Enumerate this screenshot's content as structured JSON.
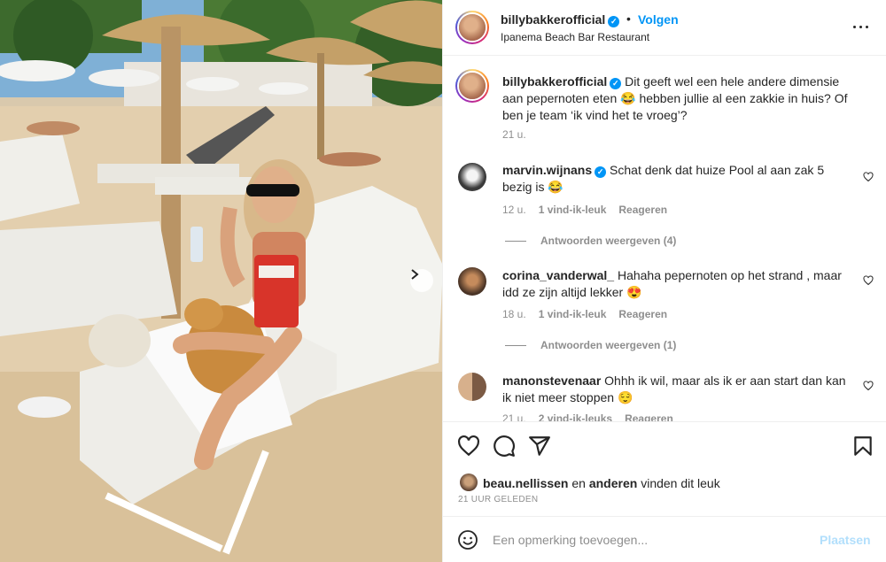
{
  "post": {
    "username": "billybakkerofficial",
    "verified": true,
    "follow_label": "Volgen",
    "separator": "•",
    "location": "Ipanema Beach Bar Restaurant",
    "more_icon": "more-horizontal-icon"
  },
  "caption": {
    "username": "billybakkerofficial",
    "text": "Dit geeft wel een hele andere dimensie aan pepernoten eten 😂 hebben jullie al een zakkie in huis? Of ben je team ‘ik vind het te vroeg’?",
    "time": "21 u."
  },
  "comments": [
    {
      "username": "marvin.wijnans",
      "verified": true,
      "text": "Schat denk dat huize Pool al aan zak 5 bezig is 😂",
      "time": "12 u.",
      "likes": "1 vind-ik-leuk",
      "reply": "Reageren",
      "view_replies": "Antwoorden weergeven (4)"
    },
    {
      "username": "corina_vanderwal_",
      "verified": false,
      "text": "Hahaha pepernoten op het strand , maar idd ze zijn altijd lekker 😍",
      "time": "18 u.",
      "likes": "1 vind-ik-leuk",
      "reply": "Reageren",
      "view_replies": "Antwoorden weergeven (1)"
    },
    {
      "username": "manonstevenaar",
      "verified": false,
      "text": "Ohhh ik wil, maar als ik er aan start dan kan ik niet meer stoppen 😌",
      "time": "21 u.",
      "likes": "2 vind-ik-leuks",
      "reply": "Reageren"
    }
  ],
  "actions": {
    "icons": [
      "heart-icon",
      "comment-icon",
      "share-icon",
      "bookmark-icon"
    ]
  },
  "likes": {
    "liker": "beau.nellissen",
    "connector": "en",
    "others": "anderen",
    "suffix": "vinden dit leuk"
  },
  "timestamp": "21 UUR GELEDEN",
  "add_comment": {
    "placeholder": "Een opmerking toevoegen...",
    "post_label": "Plaatsen"
  },
  "colors": {
    "accent": "#0095f6",
    "post_disabled": "#b2dffc",
    "secondary_text": "#8e8e8e"
  }
}
